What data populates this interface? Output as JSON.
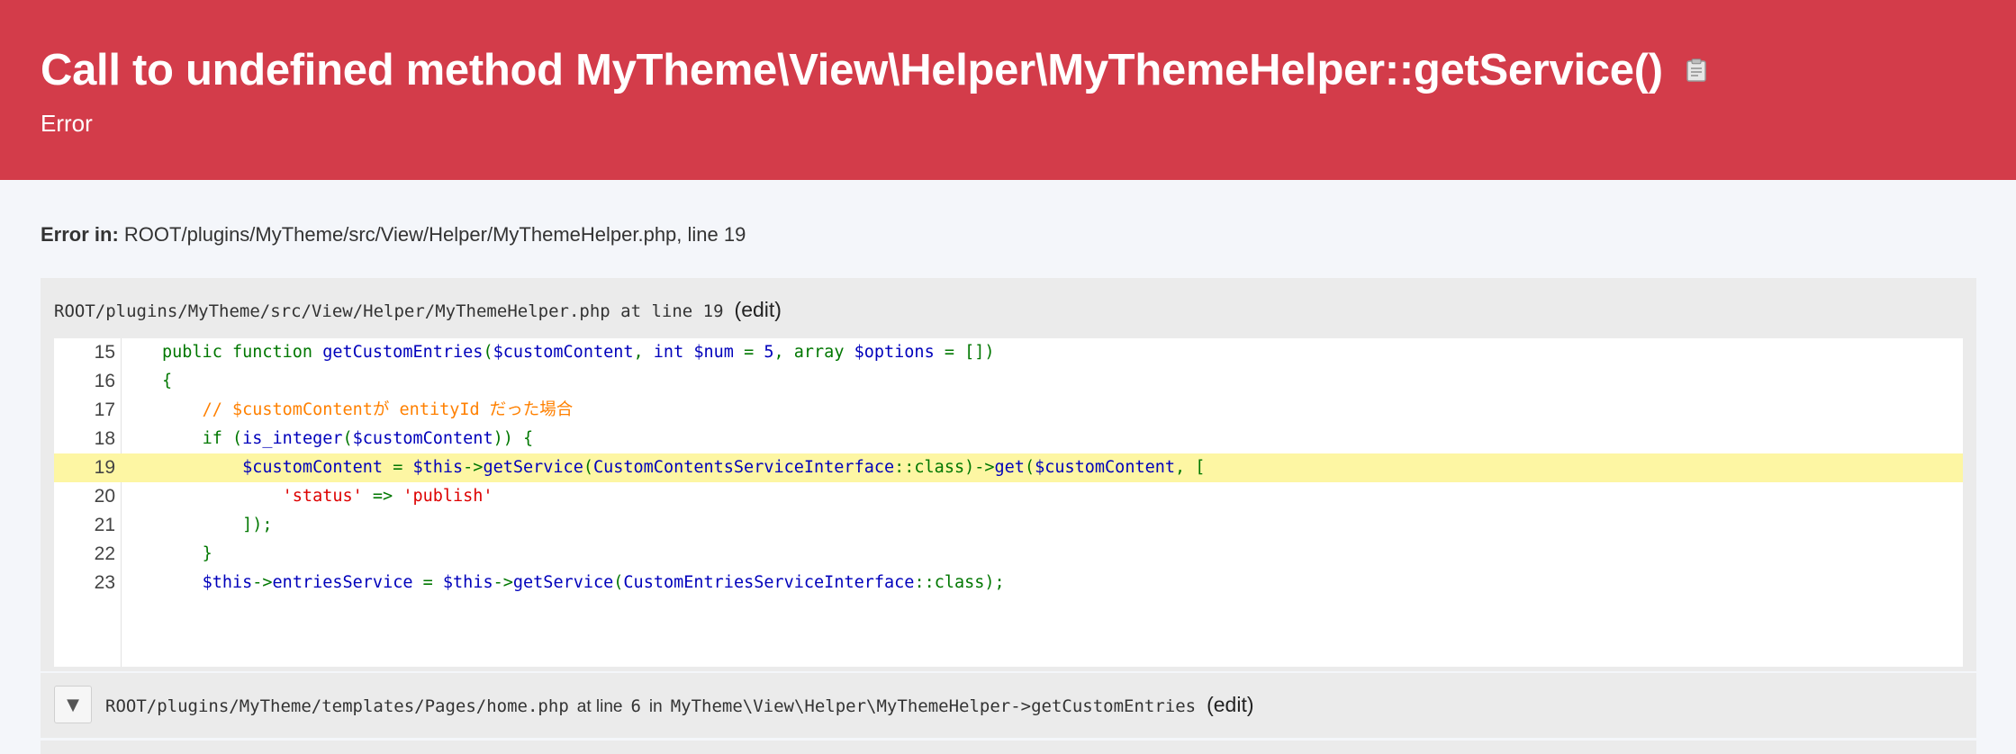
{
  "header": {
    "title": "Call to undefined method MyTheme\\View\\Helper\\MyThemeHelper::getService()",
    "subtitle": "Error",
    "background": "#d33c4a",
    "copy_icon": "clipboard-icon"
  },
  "error_location": {
    "label": "Error in:",
    "path": "ROOT/plugins/MyTheme/src/View/Helper/MyThemeHelper.php, line 19"
  },
  "frame": {
    "file": "ROOT/plugins/MyTheme/src/View/Helper/MyThemeHelper.php at line 19",
    "edit_label": "(edit)",
    "highlight_line": 19,
    "line_numbers": [
      "15",
      "16",
      "17",
      "18",
      "19",
      "20",
      "21",
      "22",
      "23"
    ]
  },
  "next_frame": {
    "toggle_icon": "▼",
    "file": "ROOT/plugins/MyTheme/templates/Pages/home.php",
    "at_text": "at line",
    "line": "6",
    "in_text": "in",
    "method": "MyTheme\\View\\Helper\\MyThemeHelper->getCustomEntries",
    "edit_label": "(edit)"
  }
}
